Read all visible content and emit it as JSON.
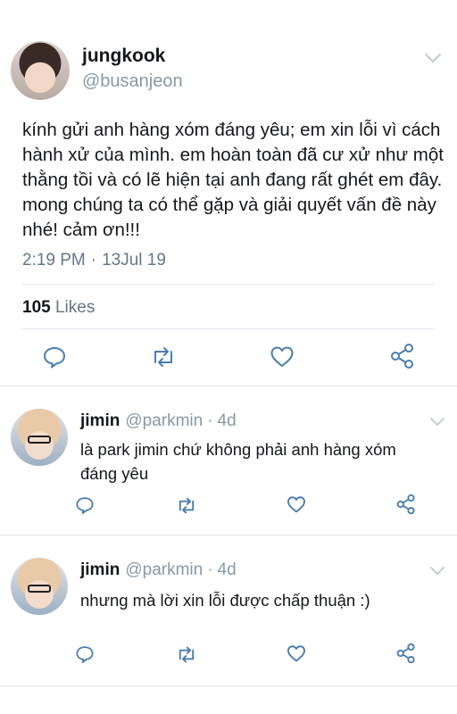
{
  "main_tweet": {
    "name": "jungkook",
    "handle": "@busanjeon",
    "text": "kính gửi anh hàng xóm đáng yêu; em xin lỗi vì cách hành xử của mình. em hoàn toàn đã cư xử như một thằng tồi và có lẽ hiện tại anh đang rất ghét em đây. mong chúng ta có thể gặp và giải quyết vấn đề này nhé! cảm ơn!!!",
    "time": "2:19 PM",
    "separator": "·",
    "date": "13Jul 19",
    "likes_count": "105",
    "likes_label": "Likes",
    "actions": [
      "reply-icon",
      "retweet-icon",
      "heart-icon",
      "share-icon"
    ]
  },
  "replies": [
    {
      "name": "jimin",
      "handle": "@parkmin",
      "separator": "·",
      "time": "4d",
      "text": "là park jimin chứ không phải anh hàng xóm đáng yêu"
    },
    {
      "name": "jimin",
      "handle": "@parkmin",
      "separator": "·",
      "time": "4d",
      "text": "nhưng mà lời xin lỗi được chấp thuận :)"
    }
  ],
  "colors": {
    "text": "#14171a",
    "secondary": "#657786",
    "icon": "#4a7eb0",
    "divider": "#e1e8ed"
  }
}
